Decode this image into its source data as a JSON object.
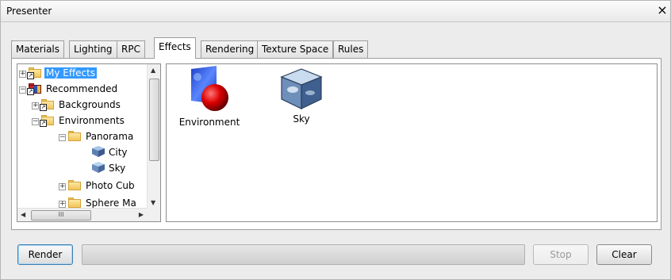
{
  "window": {
    "title": "Presenter",
    "close_label": "×"
  },
  "tabs": [
    "Materials",
    "Lighting",
    "RPC",
    "Effects",
    "Rendering",
    "Texture Space",
    "Rules"
  ],
  "active_tab": "Effects",
  "tree": {
    "items": [
      {
        "label": "My Effects",
        "expander": "+",
        "selected": true
      },
      {
        "label": "Recommended",
        "expander": "−"
      },
      {
        "label": "Backgrounds",
        "expander": "+"
      },
      {
        "label": "Environments",
        "expander": "−"
      },
      {
        "label": "Panorama",
        "expander": "−"
      },
      {
        "label": "City"
      },
      {
        "label": "Sky"
      },
      {
        "label": "Photo Cub",
        "expander": "+"
      },
      {
        "label": "Sphere Ma",
        "expander": "+"
      }
    ],
    "hscroll_grip": "III"
  },
  "effects": [
    {
      "label": "Environment",
      "icon": "environment-icon"
    },
    {
      "label": "Sky",
      "icon": "sky-cube-icon"
    }
  ],
  "buttons": {
    "render": "Render",
    "stop": "Stop",
    "clear": "Clear"
  },
  "progress": 0,
  "colors": {
    "selection": "#3399ff",
    "accent_border": "#3c7fb1"
  }
}
